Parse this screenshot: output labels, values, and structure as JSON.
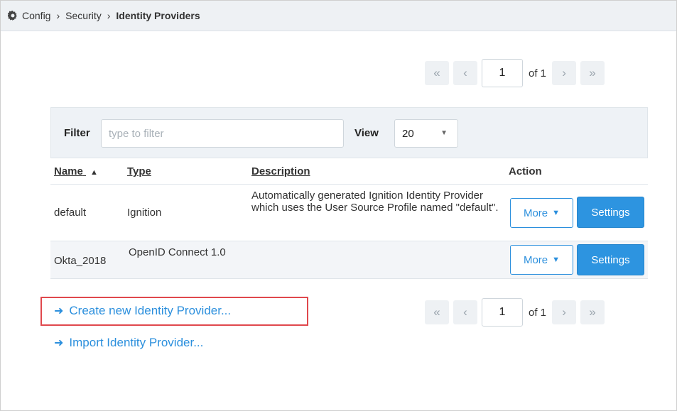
{
  "breadcrumb": {
    "root": "Config",
    "middle": "Security",
    "current": "Identity Providers"
  },
  "pager": {
    "first": "«",
    "prev": "‹",
    "next": "›",
    "last": "»",
    "page": "1",
    "of_label": "of 1"
  },
  "filter": {
    "label": "Filter",
    "placeholder": "type to filter",
    "view_label": "View",
    "view_value": "20"
  },
  "table": {
    "headers": {
      "name": "Name",
      "sort_indicator": "▲",
      "type": "Type",
      "description": "Description",
      "action": "Action"
    },
    "rows": [
      {
        "name": "default",
        "type": "Ignition",
        "description": "Automatically generated Ignition Identity Provider which uses the User Source Profile named \"default\".",
        "more": "More",
        "settings": "Settings"
      },
      {
        "name": "Okta_2018",
        "type": "OpenID Connect 1.0",
        "description": "",
        "more": "More",
        "settings": "Settings"
      }
    ]
  },
  "links": {
    "create": "Create new Identity Provider...",
    "import": "Import Identity Provider..."
  },
  "colors": {
    "accent": "#2b8fdd",
    "highlight": "#e0484d"
  }
}
